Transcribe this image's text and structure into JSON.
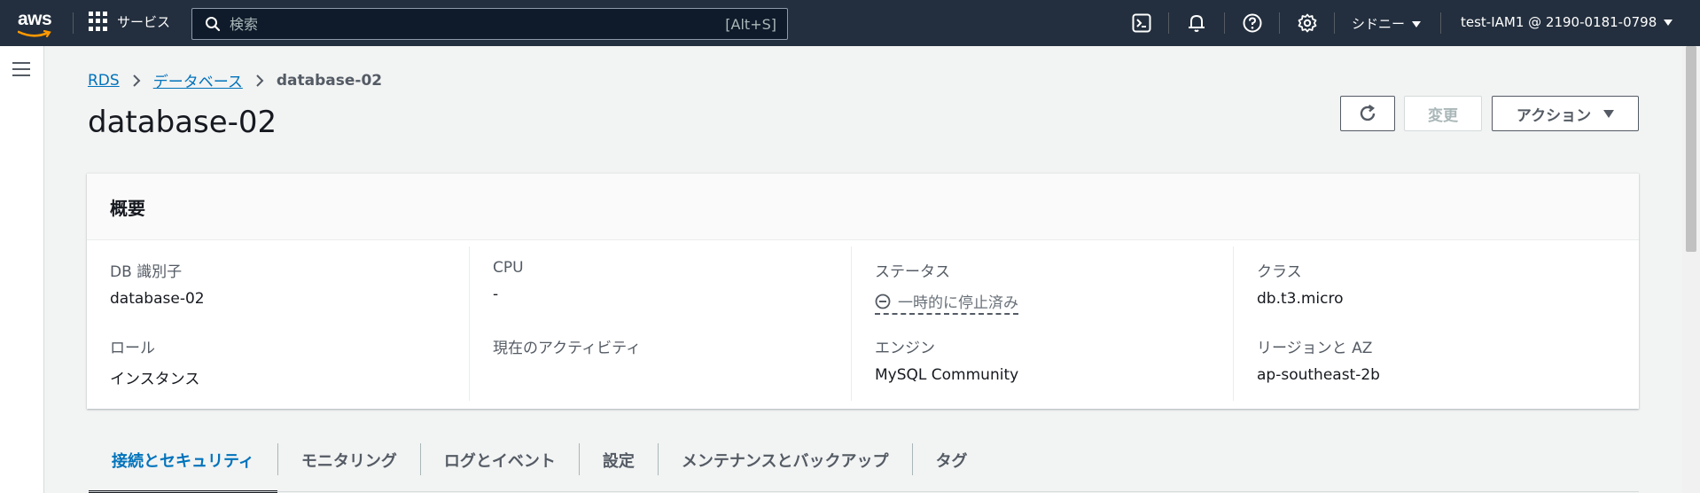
{
  "topnav": {
    "logo_text": "aws",
    "services_label": "サービス",
    "search_placeholder": "検索",
    "search_shortcut": "[Alt+S]",
    "region_label": "シドニー",
    "account_label": "test-IAM1 @ 2190-0181-0798"
  },
  "breadcrumb": {
    "items": [
      "RDS",
      "データベース"
    ],
    "current": "database-02"
  },
  "page": {
    "title": "database-02",
    "modify_label": "変更",
    "actions_label": "アクション"
  },
  "summary": {
    "header": "概要",
    "fields": {
      "db_id": {
        "label": "DB 識別子",
        "value": "database-02"
      },
      "role": {
        "label": "ロール",
        "value": "インスタンス"
      },
      "cpu": {
        "label": "CPU",
        "value": "-"
      },
      "activity": {
        "label": "現在のアクティビティ",
        "value": ""
      },
      "status": {
        "label": "ステータス",
        "value": "一時的に停止済み"
      },
      "engine": {
        "label": "エンジン",
        "value": "MySQL Community"
      },
      "class": {
        "label": "クラス",
        "value": "db.t3.micro"
      },
      "region_az": {
        "label": "リージョンと AZ",
        "value": "ap-southeast-2b"
      }
    }
  },
  "tabs": [
    "接続とセキュリティ",
    "モニタリング",
    "ログとイベント",
    "設定",
    "メンテナンスとバックアップ",
    "タグ"
  ],
  "colors": {
    "nav_bg": "#232f3e",
    "link": "#0073bb",
    "aws_orange": "#ff9900",
    "page_bg": "#f2f3f3"
  }
}
